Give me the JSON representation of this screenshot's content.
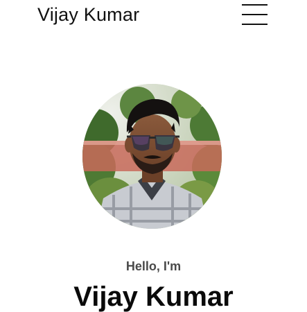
{
  "header": {
    "site_title": "Vijay Kumar",
    "menu_icon": "hamburger-menu-icon"
  },
  "hero": {
    "avatar_alt": "profile photo",
    "greeting": "Hello, I'm",
    "name": "Vijay Kumar"
  },
  "colors": {
    "text_primary": "#111111",
    "text_secondary": "#4a4a4a",
    "background": "#ffffff"
  }
}
